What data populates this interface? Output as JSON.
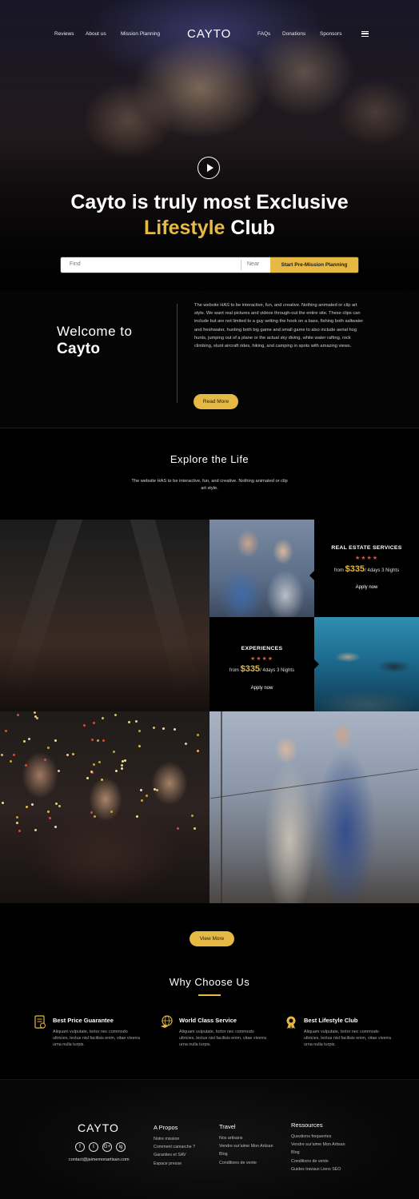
{
  "nav": {
    "left": [
      "Reviews",
      "About us",
      "Mission Planning"
    ],
    "logo": "CAYTO",
    "right": [
      "FAQs",
      "Donations",
      "Sponsors"
    ]
  },
  "hero": {
    "title_line1": "Cayto is truly most Exclusive",
    "title_gold": "Lifestyle",
    "title_rest": " Club",
    "search_find_placeholder": "Find",
    "search_near_placeholder": "Near",
    "search_button": "Start Pre-Mission Planning"
  },
  "welcome": {
    "heading_line1": "Welcome to",
    "heading_line2": "Cayto",
    "body": "The website HAS to be interactive, fun, and creative. Nothing animated or clip art style. We want real pictures and videos through-out the entire site. These clips can include but are not limited to a guy setting the hook on a bass, fishing both saltwater and freshwater, hunting both big game and small game to also include aerial hog hunts, jumping out of a plane or the actual sky diving, white water rafting, rock climbing, stunt aircraft rides, hiking, and camping in spots with amazing views.",
    "button": "Read More"
  },
  "explore": {
    "title": "Explore the Life",
    "desc": "The website HAS to be interactive, fun, and creative. Nothing animated or clip art style.",
    "cards": [
      {
        "title": "REAL ESTATE SERVICES",
        "stars": "★★★★",
        "from": "from ",
        "price": "$335",
        "per": "/ 4days 3 Nights",
        "apply": "Apply now"
      },
      {
        "title": "EXPERIENCES",
        "stars": "★★★★",
        "from": "from ",
        "price": "$335",
        "per": "/ 4days 3 Nights",
        "apply": "Apply now"
      }
    ],
    "view_more": "View More"
  },
  "why": {
    "title": "Why Choose Us",
    "features": [
      {
        "icon": "receipt-icon",
        "title": "Best Price Guarantee",
        "text": "Aliquam vulputate, tortor nec commodo ultricies, lectus nisl facilisis enim, vitae viverra urna nulla  turpis."
      },
      {
        "icon": "globe-hand-icon",
        "title": "World Class Service",
        "text": "Aliquam vulputate, tortor nec commodo ultricies, lectus nisl facilisis enim, vitae viverra urna nulla  turpis."
      },
      {
        "icon": "medal-icon",
        "title": "Best Lifestyle Club",
        "text": "Aliquam vulputate, tortor nec commodo ultricies, lectus nisl facilisis enim, vitae viverra urna nulla  turpis."
      }
    ]
  },
  "footer": {
    "logo": "CAYTO",
    "social": [
      "f",
      "t",
      "G+",
      "ig"
    ],
    "email": "contact@jaimemonartisan.com",
    "columns": [
      {
        "title": "A Propos",
        "links": [
          "Notre mission",
          "Comment camarche ?",
          "Garanties et SAV",
          "Espace presse"
        ]
      },
      {
        "title": "Travel",
        "links": [
          "Nos artisans",
          "Vendre sur'aime Mon Artisan",
          "Blog",
          "Conditions de vente"
        ]
      },
      {
        "title": "Ressources",
        "links": [
          "Questions frequentes",
          "Vendre sur'aime Mon Artisan",
          "Blog",
          "Conditions de vente",
          "Guides travaux Liens SEO"
        ]
      }
    ]
  },
  "colors": {
    "accent": "#e5b943",
    "stars": "#e5533b",
    "background": "#000000"
  }
}
